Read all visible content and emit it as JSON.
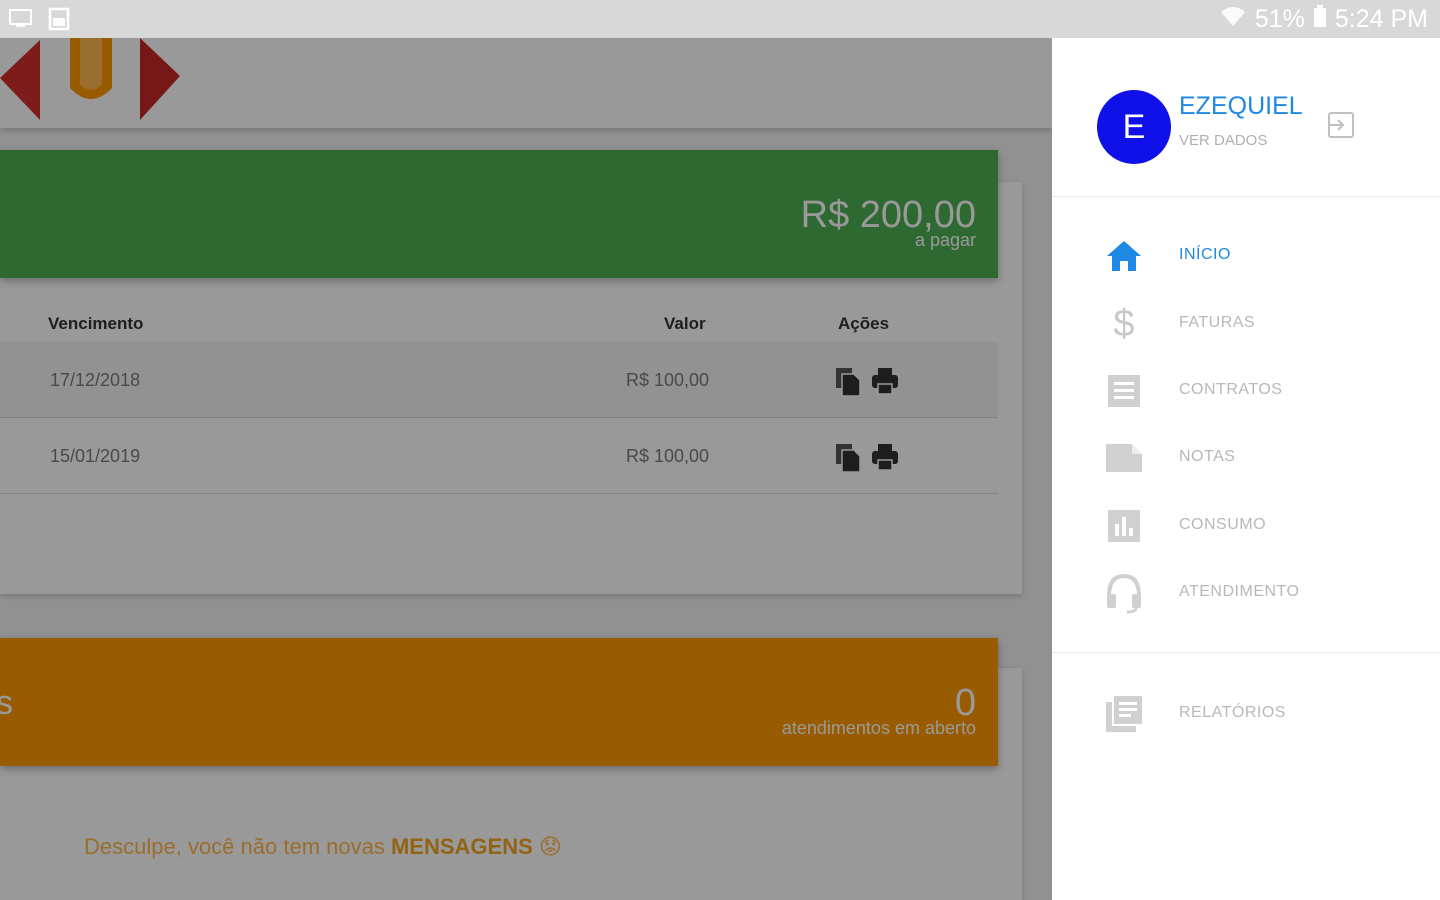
{
  "status_bar": {
    "battery": "51%",
    "time": "5:24 PM",
    "icons": [
      "cast-icon",
      "image-icon",
      "wifi-icon",
      "battery-icon"
    ]
  },
  "summary": {
    "amount": "R$ 200,00",
    "amount_caption": "a pagar"
  },
  "invoices": {
    "columns": [
      "Vencimento",
      "Valor",
      "Ações"
    ],
    "rows": [
      {
        "due": "17/12/2018",
        "value": "R$ 100,00"
      },
      {
        "due": "15/01/2019",
        "value": "R$ 100,00"
      }
    ]
  },
  "tickets": {
    "edge_text": "s",
    "count": "0",
    "caption": "atendimentos em aberto"
  },
  "messages": {
    "text": "Desculpe, você não tem novas ",
    "highlight": "MENSAGENS",
    "emoji": "😟"
  },
  "drawer": {
    "avatar_letter": "E",
    "user_name": "EZEQUIEL",
    "user_sub": "VER DADOS",
    "nav": [
      {
        "label": "INÍCIO",
        "icon": "home-icon",
        "active": true
      },
      {
        "label": "FATURAS",
        "icon": "dollar-icon",
        "active": false
      },
      {
        "label": "CONTRATOS",
        "icon": "document-icon",
        "active": false
      },
      {
        "label": "NOTAS",
        "icon": "note-icon",
        "active": false
      },
      {
        "label": "CONSUMO",
        "icon": "bar-chart-icon",
        "active": false
      },
      {
        "label": "ATENDIMENTO",
        "icon": "headset-icon",
        "active": false
      },
      {
        "label": "RELATÓRIOS",
        "icon": "reports-icon",
        "active": false
      }
    ]
  },
  "colors": {
    "green": "#4caf50",
    "orange": "#ff9800",
    "accent": "#1e88e5",
    "avatar": "#1010e8"
  }
}
